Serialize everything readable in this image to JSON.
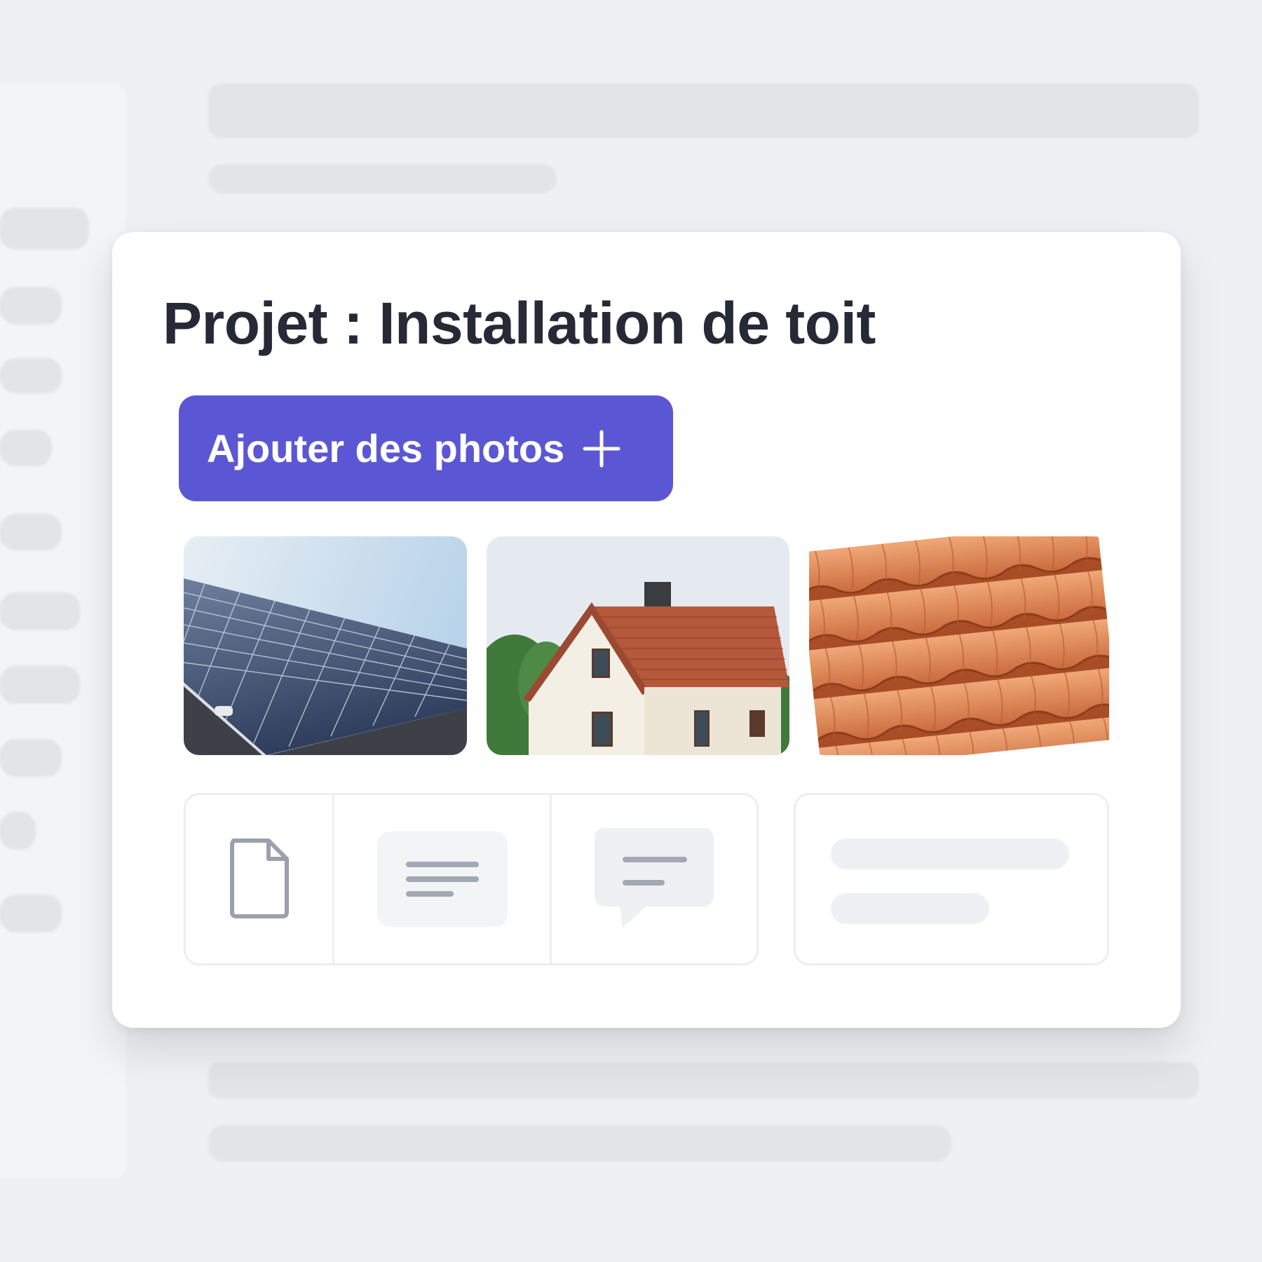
{
  "project": {
    "title": "Projet : Installation de toit"
  },
  "actions": {
    "add_photos_label": "Ajouter des photos",
    "add_photos_icon": "plus-icon"
  },
  "photos": [
    {
      "subject": "solar-panels",
      "icon": "image-thumbnail"
    },
    {
      "subject": "house",
      "icon": "image-thumbnail"
    },
    {
      "subject": "roof-tiles",
      "icon": "image-thumbnail"
    }
  ],
  "tools": [
    {
      "name": "document",
      "icon": "document-icon"
    },
    {
      "name": "text",
      "icon": "text-lines-icon"
    },
    {
      "name": "comment",
      "icon": "comment-icon"
    }
  ],
  "colors": {
    "accent": "#5b57d4",
    "title": "#262a36",
    "icon_gray": "#9aa1ad",
    "background": "#eff0f3"
  }
}
